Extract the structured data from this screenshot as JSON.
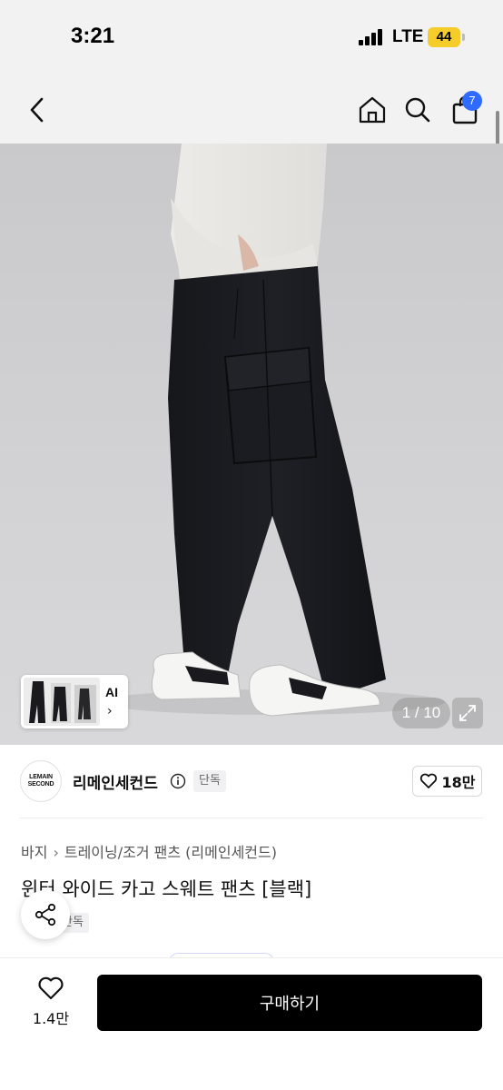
{
  "status_bar": {
    "time": "3:21",
    "network": "LTE",
    "battery": "44"
  },
  "nav": {
    "back_icon": "chevron-left-icon",
    "home_icon": "home-icon",
    "search_icon": "search-icon",
    "cart_icon": "shopping-bag-icon",
    "cart_count": "7"
  },
  "gallery": {
    "ai_label": "AI",
    "ai_chevron": "›",
    "counter": "1 / 10",
    "expand_icon": "expand-icon"
  },
  "brand": {
    "logo_line1": "LEMAIN",
    "logo_line2": "SECOND",
    "name": "리메인세컨드",
    "tag": "단독",
    "likes": "18만"
  },
  "product": {
    "breadcrumb": [
      "바지",
      "트레이닝/조거 팬츠 (리메인세컨드)"
    ],
    "breadcrumb_sep": "›",
    "title": "윈터 와이드 카고 스웨트 팬츠 [블랙]",
    "exclusive_tag": "단독"
  },
  "bottom_bar": {
    "wish_count": "1.4만",
    "buy_label": "구매하기"
  },
  "colors": {
    "accent_blue": "#2f6bff",
    "battery_yellow": "#f4cd2a",
    "buy_button": "#000000"
  }
}
